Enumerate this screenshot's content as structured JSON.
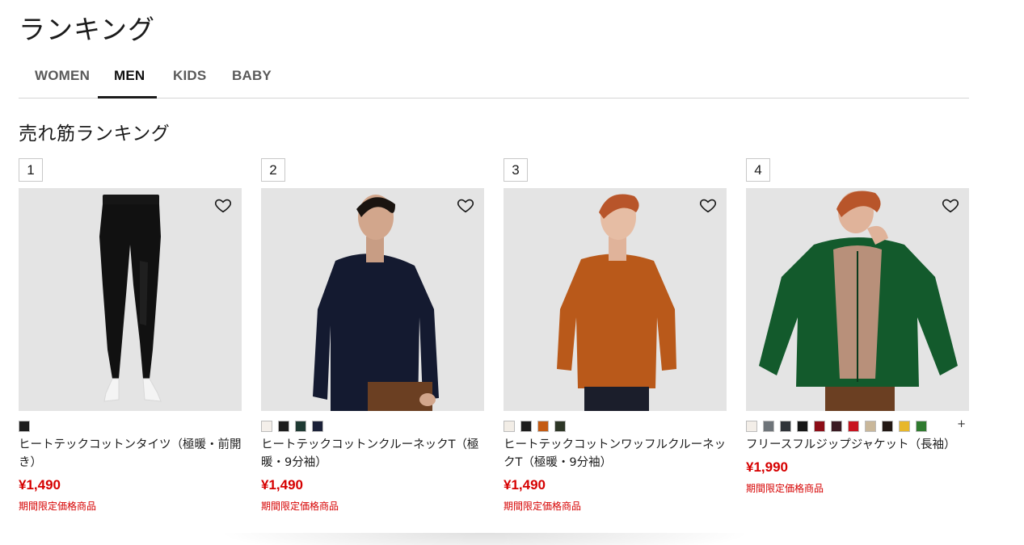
{
  "page": {
    "title": "ランキング"
  },
  "tabs": [
    {
      "label": "WOMEN",
      "active": false
    },
    {
      "label": "MEN",
      "active": true
    },
    {
      "label": "KIDS",
      "active": false
    },
    {
      "label": "BABY",
      "active": false
    }
  ],
  "section": {
    "title": "売れ筋ランキング"
  },
  "products": [
    {
      "rank": "1",
      "name": "ヒートテックコットンタイツ（極暖・前開き）",
      "price": "¥1,490",
      "promo": "期間限定価格商品",
      "favorite_icon": "heart-outline-icon",
      "colors": [
        "#1c1c1c"
      ],
      "more_colors": ""
    },
    {
      "rank": "2",
      "name": "ヒートテックコットンクルーネックT（極暖・9分袖）",
      "price": "¥1,490",
      "promo": "期間限定価格商品",
      "favorite_icon": "heart-outline-icon",
      "colors": [
        "#f4efea",
        "#1c1c1c",
        "#1f3a33",
        "#1b2138"
      ],
      "more_colors": ""
    },
    {
      "rank": "3",
      "name": "ヒートテックコットンワッフルクルーネックT（極暖・9分袖）",
      "price": "¥1,490",
      "promo": "期間限定価格商品",
      "favorite_icon": "heart-outline-icon",
      "colors": [
        "#f2ede6",
        "#1c1c1c",
        "#c45a12",
        "#2d3626"
      ],
      "more_colors": ""
    },
    {
      "rank": "4",
      "name": "フリースフルジップジャケット（長袖）",
      "price": "¥1,990",
      "promo": "期間限定価格商品",
      "favorite_icon": "heart-outline-icon",
      "colors": [
        "#f3eee8",
        "#6e7479",
        "#2f3338",
        "#151515",
        "#8c0d17",
        "#3a1a22",
        "#c8121e",
        "#c9b79a",
        "#221814",
        "#e7b72a",
        "#2f7a2f"
      ],
      "more_colors": "+"
    }
  ],
  "colors": {
    "accent_red": "#d60000",
    "text": "#1b1b1b",
    "image_bg": "#e4e4e4"
  }
}
